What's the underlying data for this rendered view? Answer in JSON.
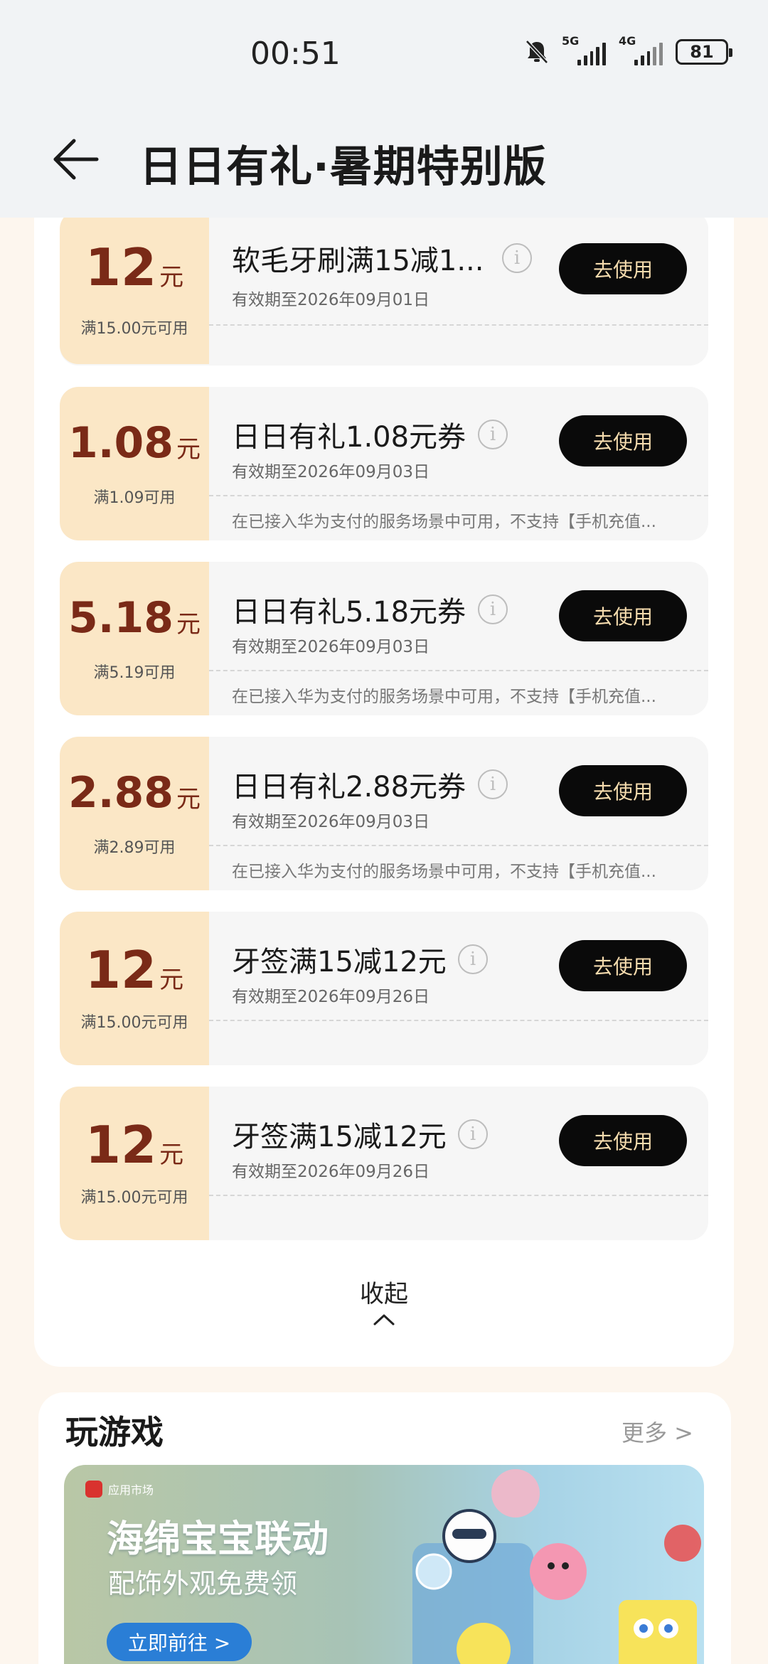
{
  "status_bar": {
    "time": "00:51",
    "network1": "5G",
    "network2": "4G",
    "battery": "81"
  },
  "header": {
    "title": "日日有礼·暑期特别版"
  },
  "coupons": [
    {
      "amount": "12",
      "unit": "元",
      "condition": "满15.00元可用",
      "title": "软毛牙刷满15减1...",
      "expiry": "有效期至2026年09月01日",
      "description": "",
      "button": "去使用"
    },
    {
      "amount": "1.08",
      "unit": "元",
      "condition": "满1.09可用",
      "title": "日日有礼1.08元券",
      "expiry": "有效期至2026年09月03日",
      "description": "在已接入华为支付的服务场景中可用，不支持【手机充值...",
      "button": "去使用"
    },
    {
      "amount": "5.18",
      "unit": "元",
      "condition": "满5.19可用",
      "title": "日日有礼5.18元券",
      "expiry": "有效期至2026年09月03日",
      "description": "在已接入华为支付的服务场景中可用，不支持【手机充值...",
      "button": "去使用"
    },
    {
      "amount": "2.88",
      "unit": "元",
      "condition": "满2.89可用",
      "title": "日日有礼2.88元券",
      "expiry": "有效期至2026年09月03日",
      "description": "在已接入华为支付的服务场景中可用，不支持【手机充值...",
      "button": "去使用"
    },
    {
      "amount": "12",
      "unit": "元",
      "condition": "满15.00元可用",
      "title": "牙签满15减12元",
      "expiry": "有效期至2026年09月26日",
      "description": "",
      "button": "去使用"
    },
    {
      "amount": "12",
      "unit": "元",
      "condition": "满15.00元可用",
      "title": "牙签满15减12元",
      "expiry": "有效期至2026年09月26日",
      "description": "",
      "button": "去使用"
    }
  ],
  "collapse_label": "收起",
  "games": {
    "title": "玩游戏",
    "more": "更多 >",
    "banner": {
      "store": "应用市场",
      "headline": "海绵宝宝联动",
      "subheadline": "配饰外观免费领",
      "button": "立即前往 >"
    }
  },
  "colors": {
    "amount": "#7a2a17",
    "amount_bg": "#fbe7c6",
    "button_bg": "#0a0a0a",
    "button_text": "#f6dcae",
    "page_bg": "#fdf6ee"
  }
}
